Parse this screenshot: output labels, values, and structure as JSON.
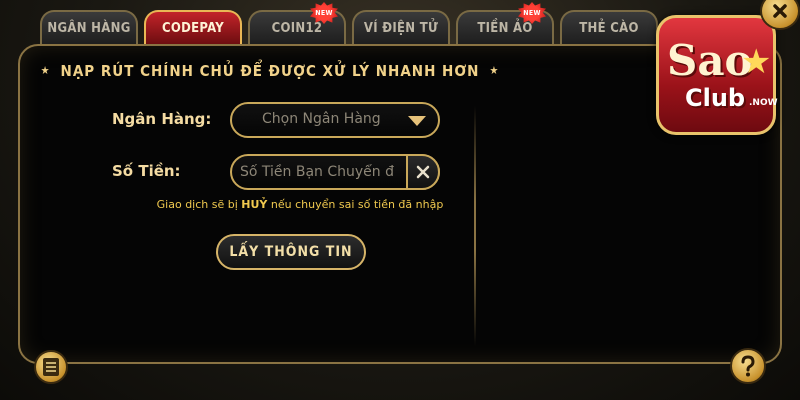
{
  "tabs": [
    {
      "label": "NGÂN HÀNG",
      "active": false,
      "new": false
    },
    {
      "label": "CODEPAY",
      "active": true,
      "new": false
    },
    {
      "label": "COIN12",
      "active": false,
      "new": true
    },
    {
      "label": "VÍ ĐIỆN TỬ",
      "active": false,
      "new": false
    },
    {
      "label": "TIỀN ẢO",
      "active": false,
      "new": true
    },
    {
      "label": "THẺ CÀO",
      "active": false,
      "new": false
    }
  ],
  "new_badge": "NEW",
  "panel": {
    "title": "NẠP RÚT CHÍNH CHỦ ĐỂ ĐƯỢC XỬ LÝ NHANH HƠN"
  },
  "form": {
    "bank_label": "Ngân Hàng:",
    "bank_select": "Chọn Ngân Hàng",
    "amount_label": "Số Tiền:",
    "amount_placeholder": "Số Tiền Bạn Chuyển đ",
    "warning_before": "Giao dịch sẽ bị ",
    "warning_bold": "HUỶ",
    "warning_after": " nếu chuyển sai số tiền đã nhập",
    "submit_label": "LẤY THÔNG TIN"
  },
  "logo": {
    "sao": "Sao",
    "club": "Club",
    "now": ".NOW"
  },
  "colors": {
    "accent_gold": "#c9a85a",
    "active_tab_red": "#c3242a",
    "warning_yellow": "#f0c94f"
  },
  "icons": {
    "history": "document-list-icon",
    "help": "question-icon",
    "close": "close-icon",
    "dropdown": "caret-down-icon",
    "clear": "clear-x-icon"
  }
}
